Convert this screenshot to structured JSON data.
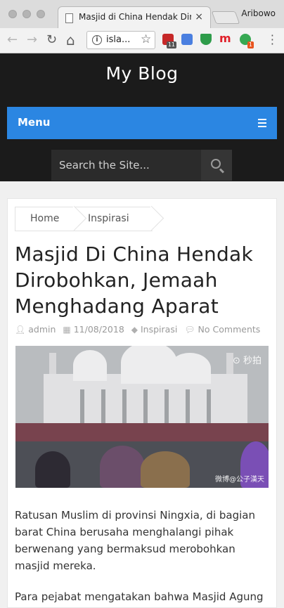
{
  "browser": {
    "tab_title": "Masjid di China Hendak Dirob",
    "tab_close": "×",
    "profile_name": "Aribowo",
    "url_text": "isla...",
    "nav": {
      "back": "←",
      "forward": "→",
      "reload": "↻",
      "home": "⌂"
    },
    "star": "☆",
    "extensions": [
      {
        "name": "shield-extension",
        "color": "#c62828",
        "badge": "11",
        "badge_color": "#555555"
      },
      {
        "name": "translate-extension",
        "color": "#4a7fe0",
        "badge": "",
        "badge_color": ""
      },
      {
        "name": "download-extension",
        "color": "#2e9c4a",
        "badge": "",
        "badge_color": ""
      },
      {
        "name": "m-extension",
        "color": "#e0202a",
        "badge": "",
        "badge_color": ""
      },
      {
        "name": "green-extension",
        "color": "#36a852",
        "badge": "1",
        "badge_color": "#e8541e"
      }
    ],
    "m_letter": "m"
  },
  "site": {
    "title": "My Blog",
    "menu_label": "Menu",
    "search_placeholder": "Search the Site..."
  },
  "breadcrumb": {
    "home": "Home",
    "category": "Inspirasi"
  },
  "post": {
    "title": "Masjid Di China Hendak Dirobohkan, Jemaah Menghadang Aparat",
    "author": "admin",
    "date": "11/08/2018",
    "category": "Inspirasi",
    "comments": "No Comments",
    "image_watermark_top": "⊙ 秒拍",
    "image_watermark_bottom": "微博@公子漢天",
    "paragraph_1": "Ratusan Muslim di provinsi Ningxia, di bagian barat China berusaha menghalangi pihak berwenang yang bermaksud merobohkan masjid mereka.",
    "paragraph_2": "Para pejabat mengatakan bahwa Masjid Agung"
  },
  "colors": {
    "menu_bar": "#2b86e2",
    "header_bg": "#1b1b1b"
  }
}
